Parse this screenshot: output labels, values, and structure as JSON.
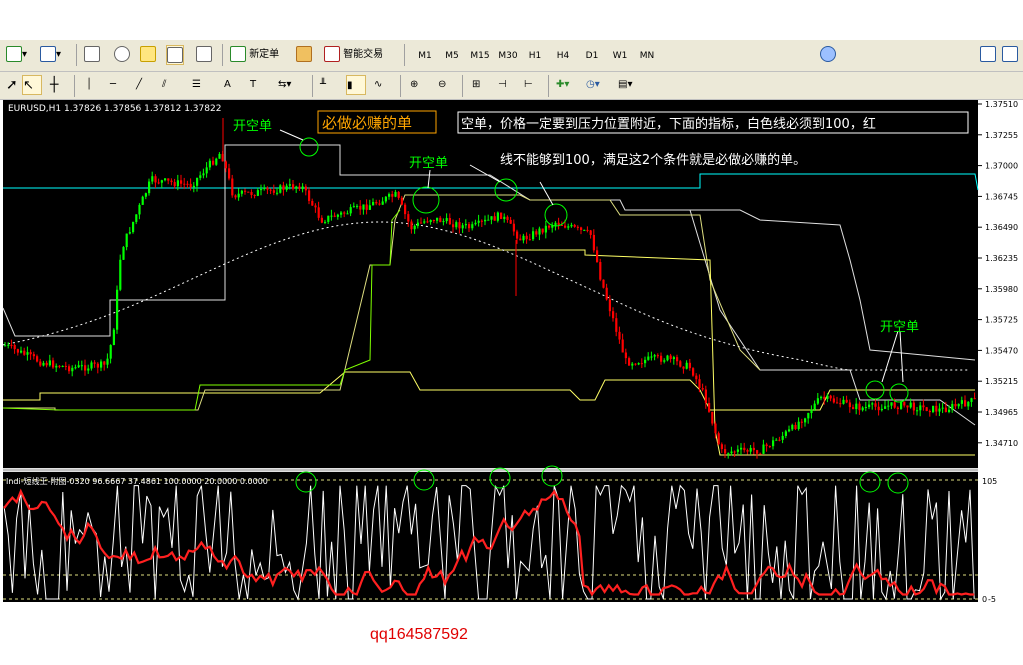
{
  "toolbar": {
    "new_order_label": "新定单",
    "auto_trading_label": "智能交易",
    "timeframes": [
      "M1",
      "M5",
      "M15",
      "M30",
      "H1",
      "H4",
      "D1",
      "W1",
      "MN"
    ],
    "selected_timeframe": "H1",
    "search_placeholder": ""
  },
  "chart": {
    "symbol_header": "EURUSD,H1  1.37826 1.37856 1.37812 1.37822",
    "price_ticks": [
      "1.37510",
      "1.37255",
      "1.37000",
      "1.36745",
      "1.36490",
      "1.36235",
      "1.35980",
      "1.35725",
      "1.35470",
      "1.35215",
      "1.34965",
      "1.34710"
    ],
    "title_badge": "必做必赚的单",
    "note_line1": "空单，价格一定要到压力位置附近，下面的指标，白色线必须到100，红",
    "note_line2": "线不能够到100，满足这2个条件就是必做必赚的单。",
    "annotations": [
      "开空单",
      "开空单",
      "开空单"
    ],
    "colors": {
      "background": "#000000",
      "bull": "#00ff00",
      "bear": "#ff0000",
      "upper_band": "#00ffff",
      "resist": "#ffff66",
      "support": "#7fff00",
      "annotation": "#00ff00",
      "note": "#ffffff",
      "badge": "#ffa500"
    }
  },
  "indicator": {
    "header": "Indi-短线王-附图-0320 96.6667 37.4861 100.0000 20.0000 0.0000",
    "ticks": [
      "105",
      "0",
      "-5"
    ],
    "levels": [
      "100",
      "20"
    ],
    "colors": {
      "white_line": "#ffffff",
      "red_line": "#ff2020"
    }
  },
  "footer_text": "qq164587592"
}
